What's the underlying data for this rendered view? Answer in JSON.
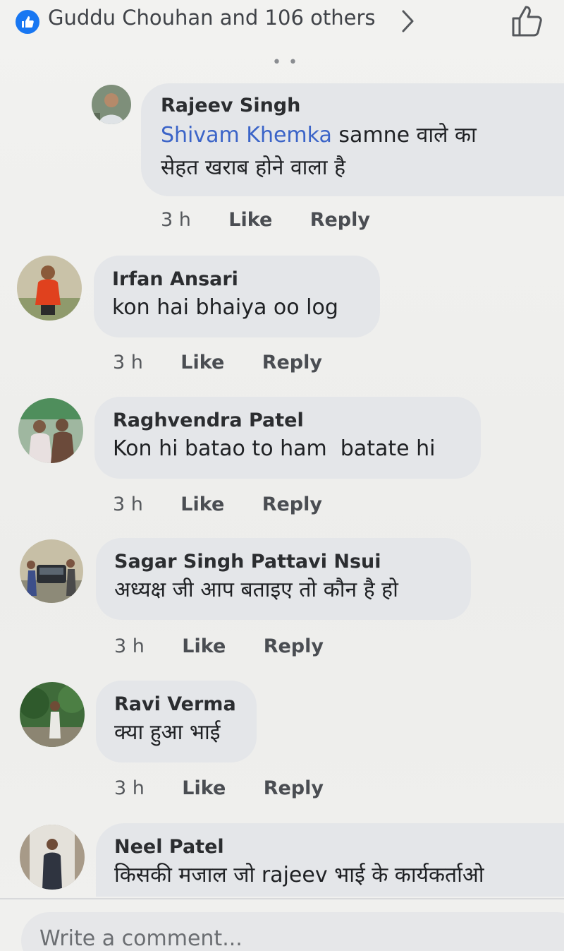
{
  "reactions": {
    "like_icon": "thumbs-up-icon",
    "summary": "Guddu Chouhan and 106 others",
    "accent_color": "#1877f2"
  },
  "comments": [
    {
      "author": "Rajeev Singh",
      "mention": "Shivam Khemka",
      "text_line1": " samne वाले का",
      "text_line2": "सेहत खराब होने वाला है",
      "time": "3 h",
      "like": "Like",
      "reply": "Reply"
    },
    {
      "author": "Irfan Ansari",
      "text": "kon hai bhaiya oo log",
      "time": "3 h",
      "like": "Like",
      "reply": "Reply"
    },
    {
      "author": "Raghvendra Patel",
      "text": "Kon hi batao to ham  batate hi",
      "time": "3 h",
      "like": "Like",
      "reply": "Reply"
    },
    {
      "author": "Sagar Singh Pattavi Nsui",
      "text": "अध्यक्ष जी आप बताइए तो कौन है हो",
      "time": "3 h",
      "like": "Like",
      "reply": "Reply"
    },
    {
      "author": "Ravi Verma",
      "text": "क्या हुआ भाई",
      "time": "3 h",
      "like": "Like",
      "reply": "Reply"
    },
    {
      "author": "Neel Patel",
      "text": "किसकी मजाल जो rajeev भाई के कार्यकर्ताओ"
    }
  ],
  "composer": {
    "placeholder": "Write a comment..."
  },
  "colors": {
    "bubble": "#e4e6e9",
    "mention": "#3b64c8"
  }
}
